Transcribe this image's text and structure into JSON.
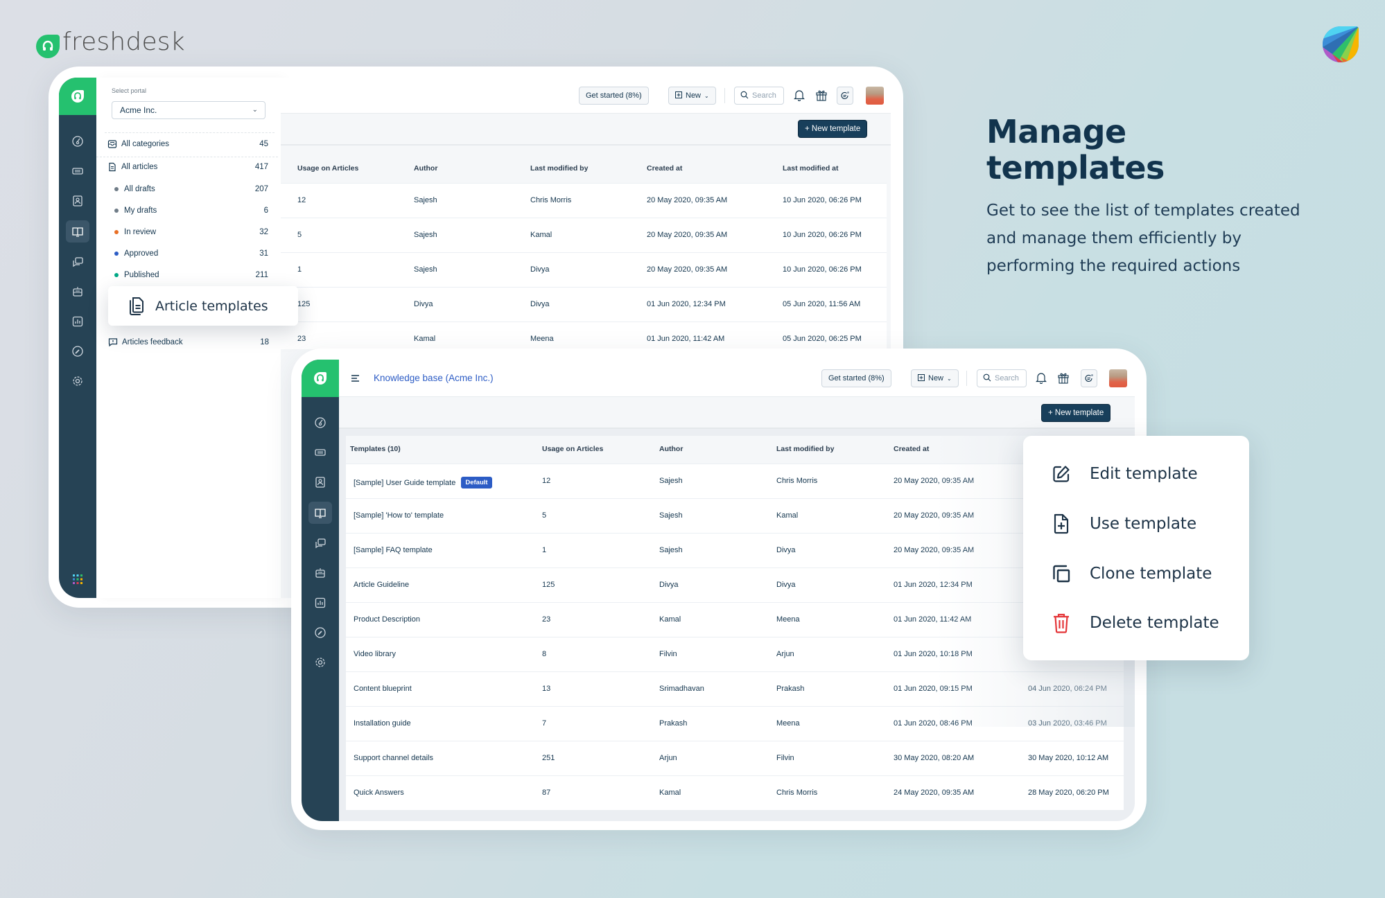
{
  "brand": {
    "name": "freshdesk",
    "accent": "#25c16f"
  },
  "headline": {
    "title_line1": "Manage",
    "title_line2": "templates",
    "body_line1": "Get to see the list of templates created",
    "body_line2": "and manage them efficiently by",
    "body_line3": "performing the required actions"
  },
  "header": {
    "get_started": "Get started (8%)",
    "new_label": "New",
    "search_placeholder": "Search",
    "new_template": "+ New template",
    "kb_title": "Knowledge base (Acme Inc.)"
  },
  "portal": {
    "label": "Select portal",
    "value": "Acme Inc."
  },
  "categories": {
    "all_categories": {
      "label": "All categories",
      "count": "45"
    },
    "all_articles": {
      "label": "All articles",
      "count": "417"
    },
    "statuses": [
      {
        "label": "All drafts",
        "count": "207",
        "color": "#6f7c87"
      },
      {
        "label": "My drafts",
        "count": "6",
        "color": "#6f7c87"
      },
      {
        "label": "In review",
        "count": "32",
        "color": "#e86f25"
      },
      {
        "label": "Approved",
        "count": "31",
        "color": "#2c5cc5"
      },
      {
        "label": "Published",
        "count": "211",
        "color": "#00a886"
      }
    ],
    "article_templates": "Article templates",
    "feedback": {
      "label": "Articles feedback",
      "count": "18"
    }
  },
  "table": {
    "columns": [
      "Templates (10)",
      "Usage on Articles",
      "Author",
      "Last modified by",
      "Created at",
      "Last modified at"
    ],
    "default_badge": "Default",
    "rows": [
      {
        "name": "[Sample] User Guide template",
        "usage": "12",
        "author": "Sajesh",
        "modified_by": "Chris Morris",
        "created": "20 May 2020, 09:35 AM",
        "modified": "10 Jun 2020, 06:26 PM",
        "is_default": true
      },
      {
        "name": "[Sample] 'How to' template",
        "usage": "5",
        "author": "Sajesh",
        "modified_by": "Kamal",
        "created": "20 May 2020, 09:35 AM",
        "modified": "10 Jun 2020, 06:26 PM"
      },
      {
        "name": "[Sample] FAQ template",
        "usage": "1",
        "author": "Sajesh",
        "modified_by": "Divya",
        "created": "20 May 2020, 09:35 AM",
        "modified": "10 Jun 2020, 06:26 PM"
      },
      {
        "name": "Article Guideline",
        "usage": "125",
        "author": "Divya",
        "modified_by": "Divya",
        "created": "01 Jun 2020, 12:34 PM",
        "modified": "05 Jun 2020, 11:56 AM"
      },
      {
        "name": "Product Description",
        "usage": "23",
        "author": "Kamal",
        "modified_by": "Meena",
        "created": "01 Jun 2020, 11:42 AM",
        "modified": "05 Jun 2020, 06:25 PM"
      },
      {
        "name": "Video library",
        "usage": "8",
        "author": "Filvin",
        "modified_by": "Arjun",
        "created": "01 Jun 2020, 10:18 PM",
        "modified": ""
      },
      {
        "name": "Content blueprint",
        "usage": "13",
        "author": "Srimadhavan",
        "modified_by": "Prakash",
        "created": "01 Jun 2020, 09:15 PM",
        "modified": "04 Jun 2020, 06:24 PM"
      },
      {
        "name": "Installation guide",
        "usage": "7",
        "author": "Prakash",
        "modified_by": "Meena",
        "created": "01 Jun 2020, 08:46 PM",
        "modified": "03 Jun 2020, 03:46 PM"
      },
      {
        "name": "Support channel details",
        "usage": "251",
        "author": "Arjun",
        "modified_by": "Filvin",
        "created": "30 May 2020, 08:20 AM",
        "modified": "30 May 2020, 10:12 AM"
      },
      {
        "name": "Quick Answers",
        "usage": "87",
        "author": "Kamal",
        "modified_by": "Chris Morris",
        "created": "24 May 2020, 09:35 AM",
        "modified": "28 May 2020, 06:20 PM"
      }
    ]
  },
  "context_menu": {
    "items": [
      {
        "label": "Edit template",
        "icon": "edit-icon"
      },
      {
        "label": "Use template",
        "icon": "file-plus-icon"
      },
      {
        "label": "Clone template",
        "icon": "clone-icon"
      },
      {
        "label": "Delete template",
        "icon": "trash-icon",
        "color": "#e43538"
      }
    ]
  }
}
